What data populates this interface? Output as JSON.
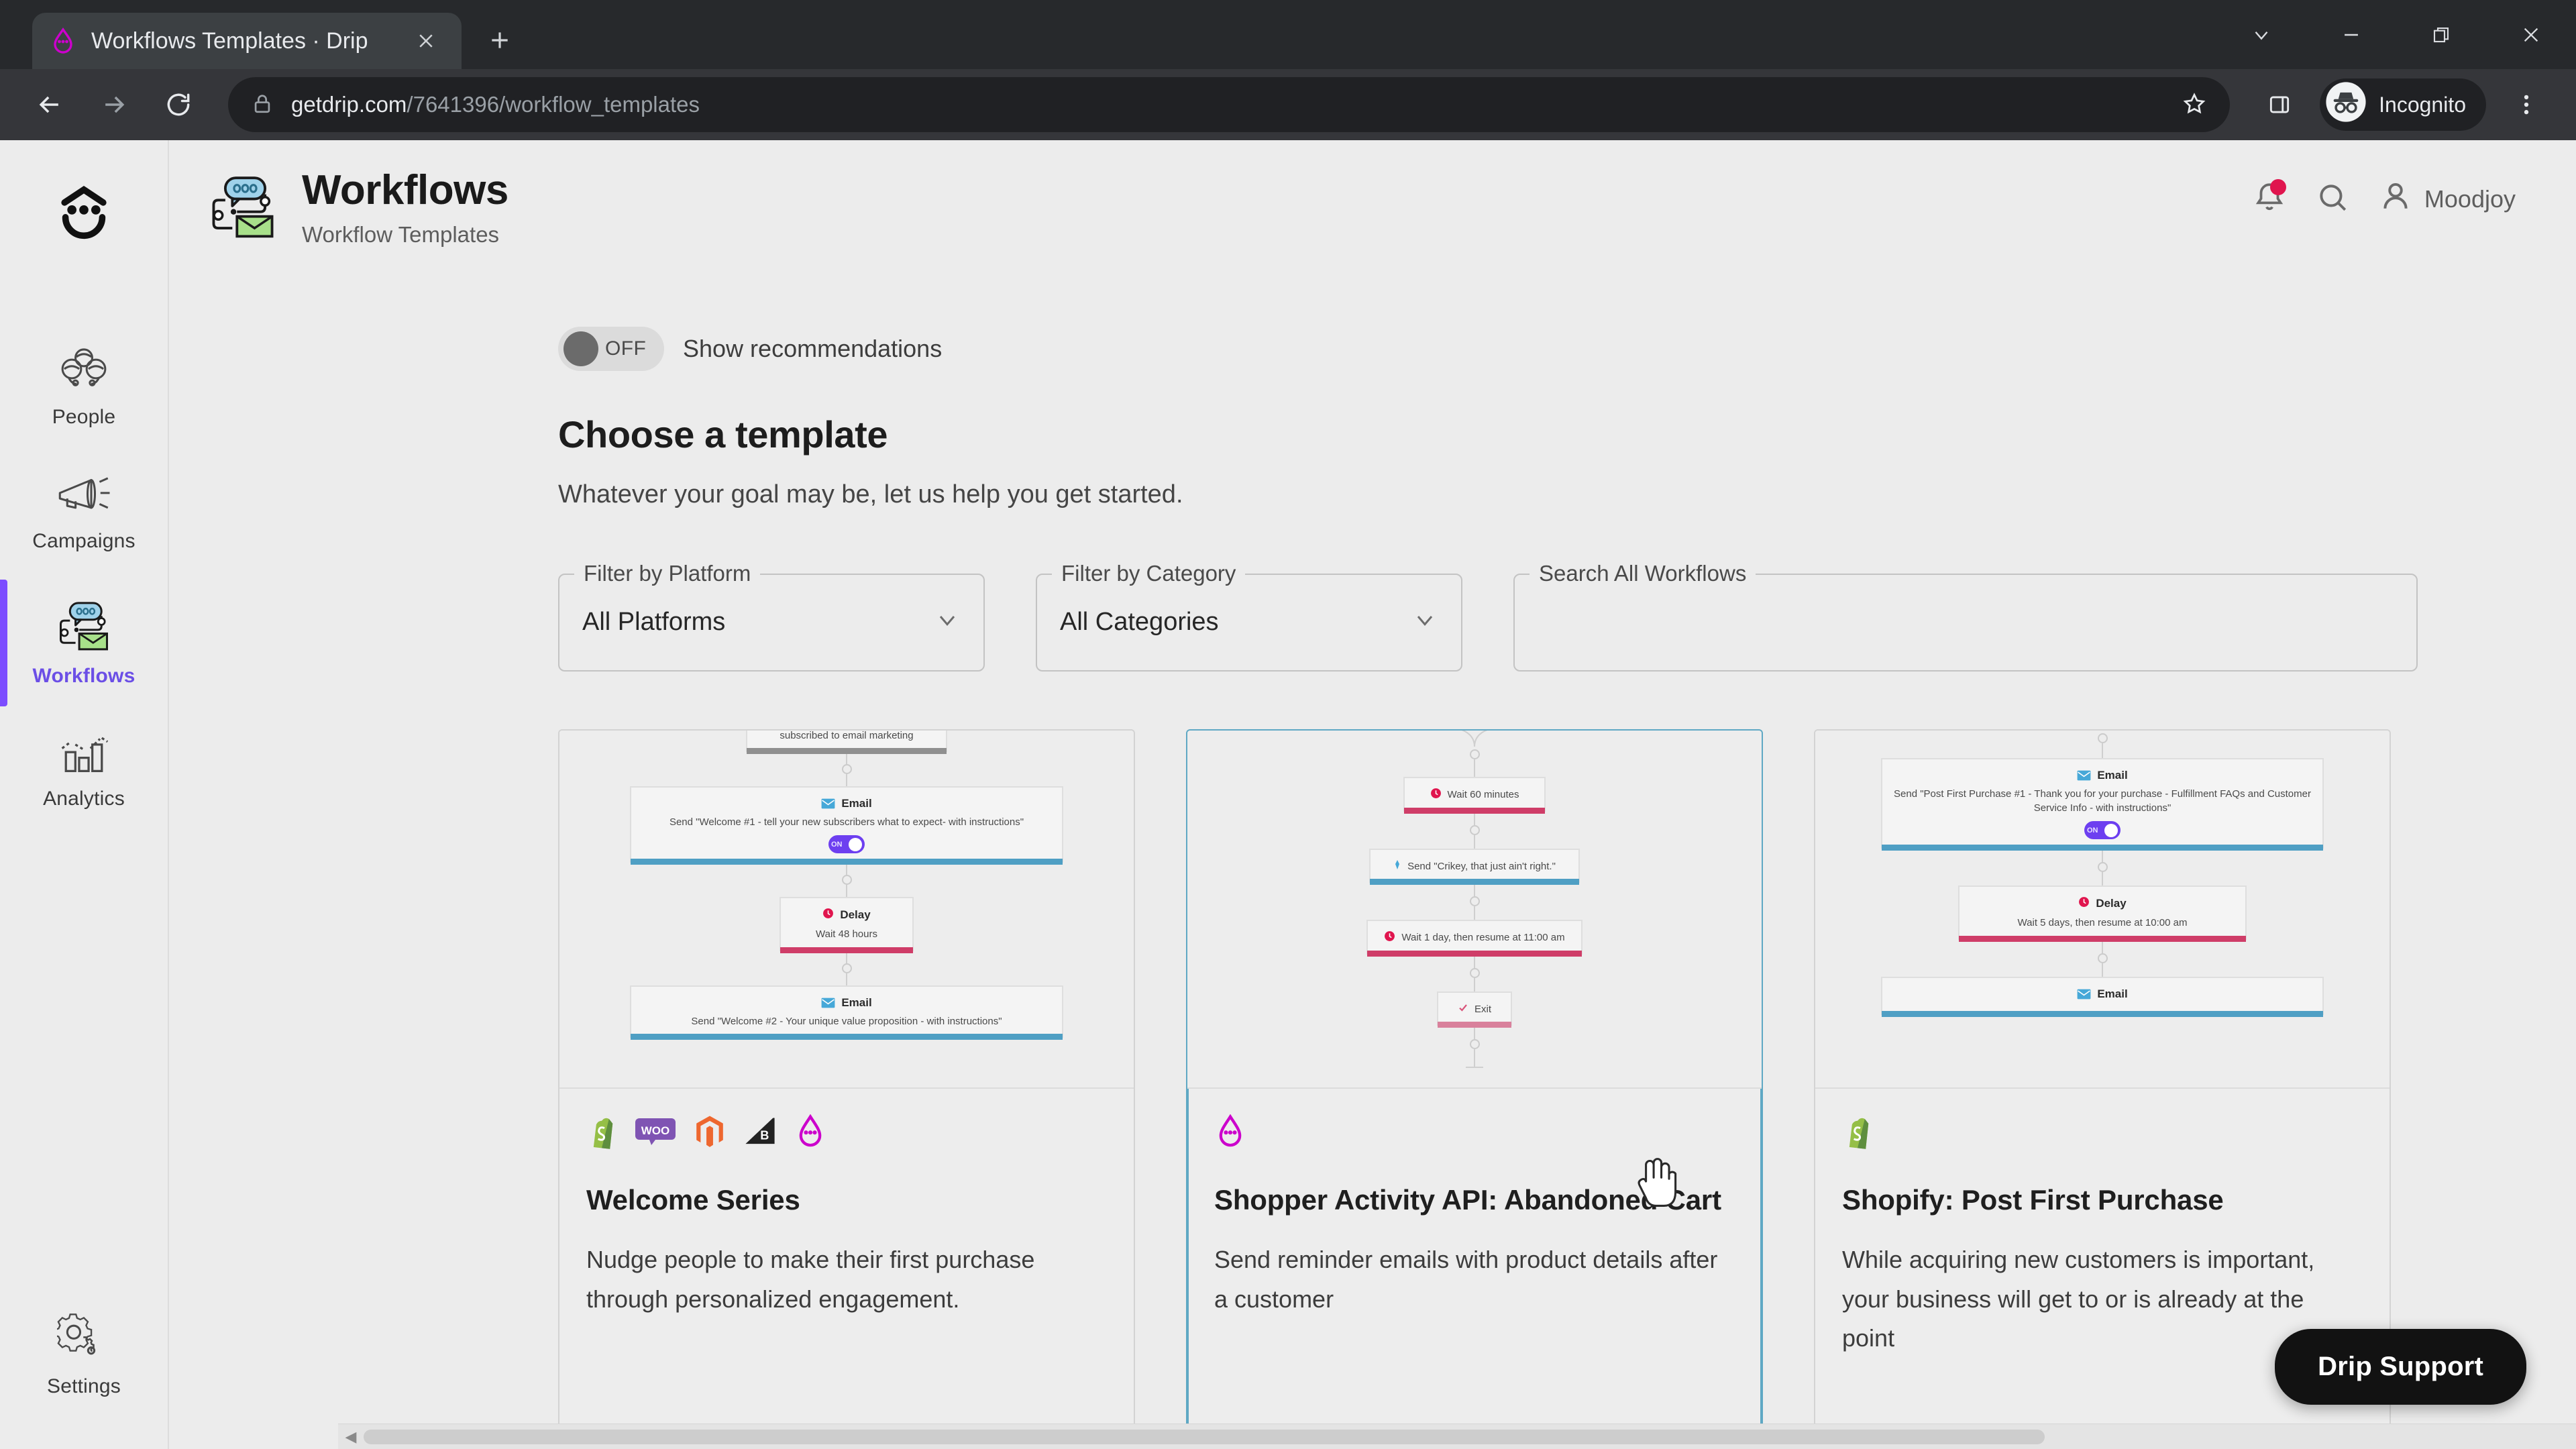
{
  "browser": {
    "tab": {
      "title": "Workflows Templates · Drip",
      "favicon_icon": "drip-logo-icon",
      "close_icon": "close-icon"
    },
    "new_tab_icon": "plus-icon",
    "window_controls": [
      {
        "name": "tab-search",
        "icon": "chevron-down-icon",
        "glyph": "∨"
      },
      {
        "name": "minimize",
        "icon": "minimize-icon",
        "glyph": "−"
      },
      {
        "name": "maximize",
        "icon": "restore-icon",
        "glyph": "❐"
      },
      {
        "name": "close",
        "icon": "close-icon",
        "glyph": "✕"
      }
    ],
    "nav": {
      "back_icon": "back-arrow-icon",
      "forward_icon": "forward-arrow-icon",
      "reload_icon": "reload-icon"
    },
    "omnibox": {
      "lock_icon": "lock-icon",
      "url_domain": "getdrip.com",
      "url_path": "/7641396/workflow_templates",
      "bookmark_icon": "star-icon"
    },
    "side_panel_icon": "side-panel-icon",
    "incognito": {
      "label": "Incognito",
      "icon": "incognito-icon"
    },
    "menu_icon": "three-dot-menu-icon"
  },
  "sidebar": {
    "brand_icon": "drip-smiley-logo",
    "items": [
      {
        "label": "People",
        "icon": "people-icon",
        "active": false
      },
      {
        "label": "Campaigns",
        "icon": "megaphone-icon",
        "active": false
      },
      {
        "label": "Workflows",
        "icon": "workflow-icon",
        "active": true
      },
      {
        "label": "Analytics",
        "icon": "bar-chart-icon",
        "active": false
      }
    ],
    "bottom_items": [
      {
        "label": "Settings",
        "icon": "gear-icon",
        "active": false
      }
    ]
  },
  "header": {
    "icon": "workflow-icon",
    "title": "Workflows",
    "subtitle": "Workflow Templates",
    "notifications_icon": "bell-icon",
    "has_notification_dot": true,
    "search_icon": "search-icon",
    "account_icon": "person-icon",
    "account_name": "Moodjoy"
  },
  "main": {
    "recommendations_toggle": {
      "state": "OFF",
      "label": "Show recommendations",
      "on": false
    },
    "heading": "Choose a template",
    "lede": "Whatever your goal may be, let us help you get started.",
    "filters": {
      "platform": {
        "legend": "Filter by Platform",
        "value": "All Platforms",
        "caret_icon": "chevron-down-icon"
      },
      "category": {
        "legend": "Filter by Category",
        "value": "All Categories",
        "caret_icon": "chevron-down-icon"
      },
      "search": {
        "legend": "Search All Workflows",
        "value": "",
        "placeholder": ""
      }
    },
    "cards": [
      {
        "title": "Welcome Series",
        "description": "Nudge people to make their first purchase through personalized engagement.",
        "platform_icons": [
          "shopify-icon",
          "woocommerce-icon",
          "magento-icon",
          "bigcommerce-icon",
          "drip-icon"
        ],
        "hovered": false,
        "preview_nodes": [
          {
            "type": "trigger",
            "kind": "partial",
            "head": "",
            "text": "subscribed to email marketing",
            "bar": "grey",
            "toggle": null
          },
          {
            "type": "email",
            "kind": "full",
            "head": "Email",
            "text": "Send \"Welcome #1 - tell your new subscribers what to expect- with instructions\"",
            "bar": "blue",
            "toggle": "ON"
          },
          {
            "type": "delay",
            "kind": "full",
            "head": "Delay",
            "text": "Wait 48 hours",
            "bar": "pink",
            "toggle": null
          },
          {
            "type": "email",
            "kind": "full",
            "head": "Email",
            "text": "Send \"Welcome #2 - Your unique value proposition - with instructions\"",
            "bar": "blue",
            "toggle": null
          }
        ]
      },
      {
        "title": "Shopper Activity API: Abandoned Cart",
        "description": "Send reminder emails with product details after a customer",
        "platform_icons": [
          "drip-icon"
        ],
        "hovered": true,
        "preview_nodes": [
          {
            "type": "delay",
            "kind": "inline",
            "head": "",
            "text": "Wait 60 minutes",
            "bar": "pink",
            "toggle": null
          },
          {
            "type": "email",
            "kind": "inline",
            "head": "",
            "text": "Send \"Crikey, that just ain't right.\"",
            "bar": "blue",
            "toggle": null
          },
          {
            "type": "delay",
            "kind": "inline",
            "head": "",
            "text": "Wait 1 day, then resume at 11:00 am",
            "bar": "pink",
            "toggle": null
          },
          {
            "type": "exit",
            "kind": "inline",
            "head": "",
            "text": "Exit",
            "bar": "pink-lt",
            "toggle": null
          }
        ]
      },
      {
        "title": "Shopify: Post First Purchase",
        "description": "While acquiring new customers is important, your business will get to or is already at the point",
        "platform_icons": [
          "shopify-icon"
        ],
        "hovered": false,
        "preview_nodes": [
          {
            "type": "email",
            "kind": "full",
            "head": "Email",
            "text": "Send \"Post First Purchase #1 - Thank you for your purchase - Fulfillment FAQs and Customer Service Info - with instructions\"",
            "bar": "blue",
            "toggle": "ON"
          },
          {
            "type": "delay",
            "kind": "full",
            "head": "Delay",
            "text": "Wait 5 days, then resume at 10:00 am",
            "bar": "pink",
            "toggle": null
          },
          {
            "type": "email",
            "kind": "full",
            "head": "Email",
            "text": "",
            "bar": "blue",
            "toggle": null
          }
        ]
      }
    ],
    "support_button": "Drip Support"
  },
  "colors": {
    "accent_purple": "#7c4dff",
    "drip_magenta": "#cc00cc",
    "node_email_bar": "#4f9fc4",
    "node_delay_bar": "#cf3d68",
    "notification_dot": "#e0154e",
    "card_hover_border": "#5fa8c4",
    "support_bg": "#121212"
  }
}
